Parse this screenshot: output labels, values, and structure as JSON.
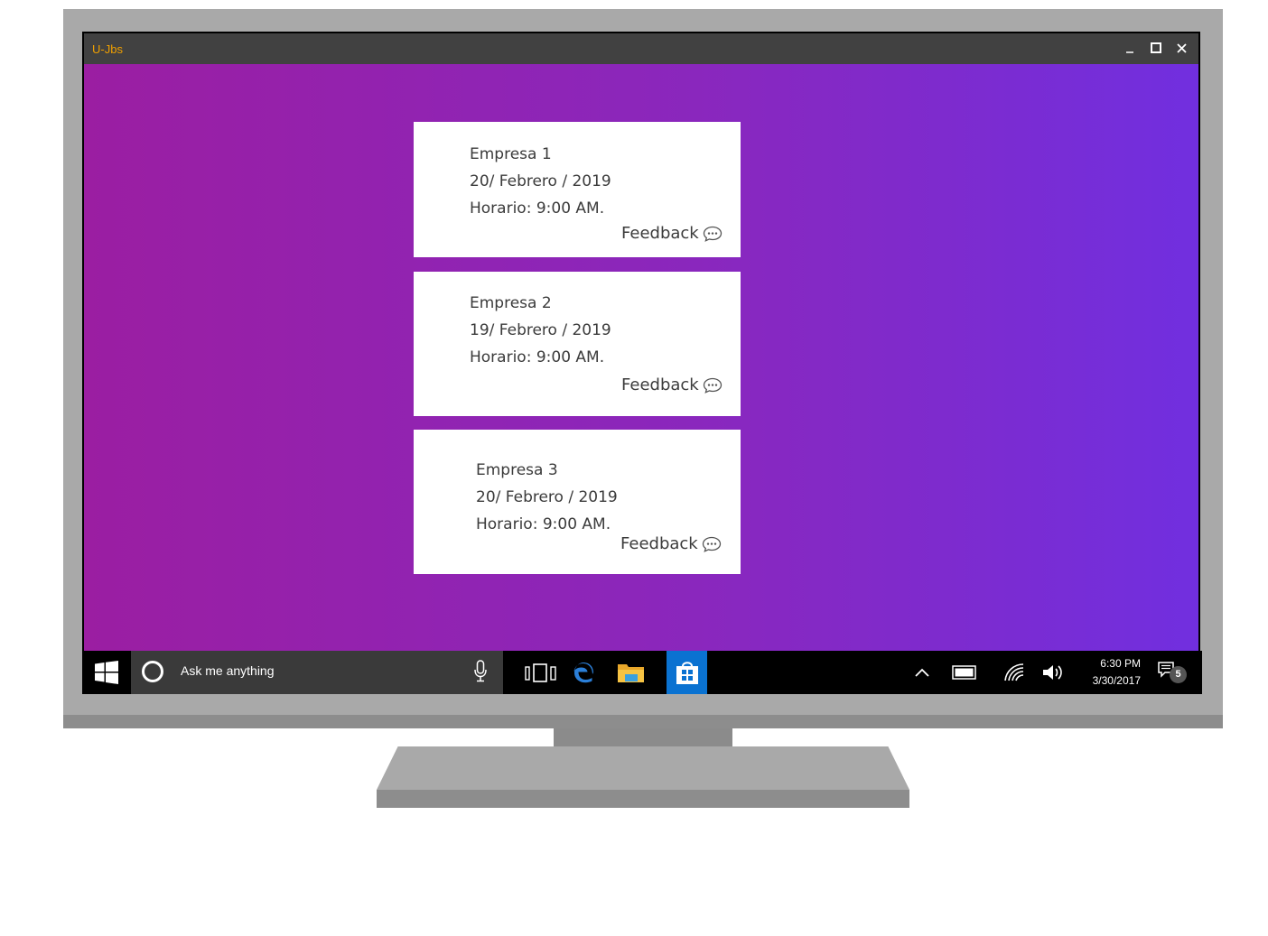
{
  "window": {
    "title": "U-Jbs",
    "minimize_label": "_",
    "maximize_label": "☐",
    "close_label": "✕",
    "title_color": "#f0a000"
  },
  "cards": [
    {
      "company": "Empresa 1",
      "date": "20/ Febrero / 2019",
      "schedule": "Horario: 9:00 AM.",
      "feedback_label": "Feedback"
    },
    {
      "company": "Empresa 2",
      "date": "19/ Febrero / 2019",
      "schedule": "Horario: 9:00 AM.",
      "feedback_label": "Feedback"
    },
    {
      "company": "Empresa 3",
      "date": "20/ Febrero / 2019",
      "schedule": "Horario: 9:00 AM.",
      "feedback_label": "Feedback"
    }
  ],
  "taskbar": {
    "search_placeholder": "Ask me anything",
    "time": "6:30 PM",
    "date": "3/30/2017",
    "notification_count": "5",
    "icons": [
      "windows-start-icon",
      "cortana-icon",
      "microphone-icon",
      "task-view-icon",
      "edge-icon",
      "file-explorer-icon",
      "store-icon",
      "chevron-up-icon",
      "battery-icon",
      "wifi-icon",
      "volume-icon",
      "action-center-icon"
    ]
  },
  "colors": {
    "gradient_start": "#9b1ea2",
    "gradient_end": "#712fdf",
    "store_blue": "#0a72d1"
  }
}
